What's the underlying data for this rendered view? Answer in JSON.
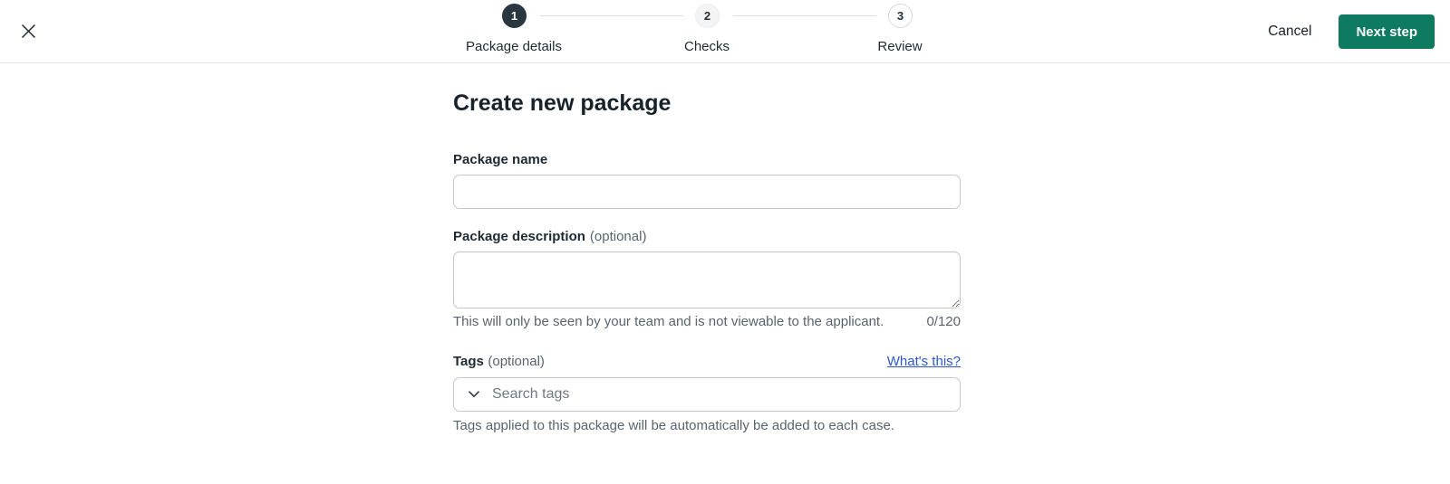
{
  "header": {
    "cancel_label": "Cancel",
    "next_label": "Next step",
    "steps": [
      {
        "number": "1",
        "label": "Package details",
        "state": "active"
      },
      {
        "number": "2",
        "label": "Checks",
        "state": "upcoming"
      },
      {
        "number": "3",
        "label": "Review",
        "state": "upcoming"
      }
    ]
  },
  "main": {
    "title": "Create new package",
    "package_name": {
      "label": "Package name",
      "value": ""
    },
    "package_description": {
      "label": "Package description",
      "optional": "(optional)",
      "value": "",
      "helper": "This will only be seen by your team and is not viewable to the applicant.",
      "counter": "0/120"
    },
    "tags": {
      "label": "Tags",
      "optional": "(optional)",
      "link": "What's this?",
      "placeholder": "Search tags",
      "helper": "Tags applied to this package will be automatically be added to each case."
    }
  },
  "colors": {
    "accent_green": "#0e7a60",
    "link_blue": "#2d56cf",
    "step_active_bg": "#2a3740"
  }
}
